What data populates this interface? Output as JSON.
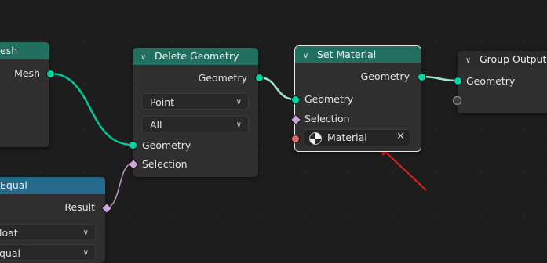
{
  "nodes": {
    "mesh_node": {
      "title": "esh",
      "output": "Mesh"
    },
    "delete_geometry": {
      "title": "Delete Geometry",
      "output": "Geometry",
      "domain_select": "Point",
      "mode_select": "All",
      "inputs": [
        "Geometry",
        "Selection"
      ]
    },
    "set_material": {
      "title": "Set Material",
      "output": "Geometry",
      "inputs": [
        "Geometry",
        "Selection"
      ],
      "material_field": "Material"
    },
    "group_output": {
      "title": "Group Output",
      "input": "Geometry"
    },
    "equal_node": {
      "title": "Equal",
      "output": "Result",
      "type_select": "loat",
      "op_select": "qual"
    }
  },
  "colors": {
    "geometry_socket": "#00d6a3",
    "selection_socket": "#cfa4dd",
    "material_socket": "#e36a6a",
    "annotation_arrow": "#e02020"
  }
}
